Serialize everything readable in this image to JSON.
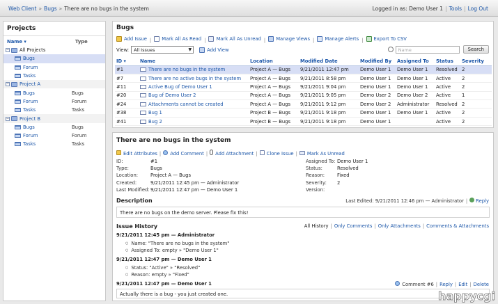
{
  "breadcrumb": [
    "Web Client",
    "Bugs",
    "There are no bugs in the system"
  ],
  "topbar": {
    "logged_in": "Logged in as: Demo User 1",
    "tools": "Tools",
    "logout": "Log Out"
  },
  "sidebar": {
    "title": "Projects",
    "col_name": "Name",
    "col_type": "Type",
    "rows": [
      {
        "label": "All Projects",
        "type": "",
        "kind": "root"
      },
      {
        "label": "Bugs",
        "type": "",
        "kind": "child"
      },
      {
        "label": "Forum",
        "type": "",
        "kind": "child"
      },
      {
        "label": "Tasks",
        "type": "",
        "kind": "child"
      },
      {
        "label": "Project A",
        "type": "",
        "kind": "project"
      },
      {
        "label": "Bugs",
        "type": "Bugs",
        "kind": "child"
      },
      {
        "label": "Forum",
        "type": "Forum",
        "kind": "child"
      },
      {
        "label": "Tasks",
        "type": "Tasks",
        "kind": "child"
      },
      {
        "label": "Project B",
        "type": "",
        "kind": "project"
      },
      {
        "label": "Bugs",
        "type": "Bugs",
        "kind": "child"
      },
      {
        "label": "Forum",
        "type": "Forum",
        "kind": "child"
      },
      {
        "label": "Tasks",
        "type": "Tasks",
        "kind": "child"
      }
    ]
  },
  "bugs": {
    "title": "Bugs",
    "toolbar": [
      "Add Issue",
      "Mark All As Read",
      "Mark All As Unread",
      "Manage Views",
      "Manage Alerts",
      "Export To CSV"
    ],
    "view_label": "View:",
    "view_value": "All Issues",
    "add_view": "Add View",
    "search_placeholder": "Name",
    "search_button": "Search",
    "columns": [
      "ID",
      "Name",
      "Location",
      "Modified Date",
      "Modified By",
      "Assigned To",
      "Status",
      "Severity"
    ],
    "rows": [
      [
        "#1",
        "There are no bugs in the system",
        "Project A — Bugs",
        "9/21/2011 12:47 pm",
        "Demo User 1",
        "Demo User 1",
        "Resolved",
        "2"
      ],
      [
        "#7",
        "There are no active bugs in the system",
        "Project A — Bugs",
        "9/21/2011 8:58 pm",
        "Demo User 1",
        "Demo User 1",
        "Active",
        "2"
      ],
      [
        "#11",
        "Active Bug of Demo User 1",
        "Project A — Bugs",
        "9/21/2011 9:04 pm",
        "Demo User 1",
        "Demo User 1",
        "Active",
        "2"
      ],
      [
        "#20",
        "Bug of Demo User 2",
        "Project A — Bugs",
        "9/21/2011 9:05 pm",
        "Demo User 2",
        "Demo User 2",
        "Active",
        "1"
      ],
      [
        "#24",
        "Attachments cannot be created",
        "Project A — Bugs",
        "9/21/2011 9:12 pm",
        "Demo User 2",
        "Administrator",
        "Resolved",
        "2"
      ],
      [
        "#38",
        "Bug 1",
        "Project B — Bugs",
        "9/21/2011 9:18 pm",
        "Demo User 1",
        "Demo User 1",
        "Active",
        "2"
      ],
      [
        "#41",
        "Bug 2",
        "Project B — Bugs",
        "9/21/2011 9:18 pm",
        "Demo User 1",
        "",
        "Active",
        "2"
      ]
    ]
  },
  "detail": {
    "title": "There are no bugs in the system",
    "toolbar": [
      "Edit Attributes",
      "Add Comment",
      "Add Attachment",
      "Clone Issue",
      "Mark As Unread"
    ],
    "left_props": [
      [
        "ID:",
        "#1"
      ],
      [
        "Type:",
        "Bugs"
      ],
      [
        "Location:",
        "Project A — Bugs"
      ],
      [
        "Created:",
        "9/21/2011 12:45 pm — Administrator"
      ],
      [
        "Last Modified:",
        "9/21/2011 12:47 pm — Demo User 1"
      ]
    ],
    "right_props": [
      [
        "Assigned To:",
        "Demo User 1"
      ],
      [
        "Status:",
        "Resolved"
      ],
      [
        "Reason:",
        "Fixed"
      ],
      [
        "Severity:",
        "2"
      ],
      [
        "Version:",
        ""
      ]
    ],
    "description_title": "Description",
    "last_edited": "Last Edited: 9/21/2011 12:46 pm — Administrator",
    "reply": "Reply",
    "description": "There are no bugs on the demo server. Please fix this!",
    "history_title": "Issue History",
    "history_links": [
      "All History",
      "Only Comments",
      "Only Attachments",
      "Comments & Attachments"
    ],
    "entries": [
      {
        "head": "9/21/2011 12:45 pm — Administrator",
        "items": [
          "Name: \"There are no bugs in the system\"",
          "Assigned To: empty » \"Demo User 1\""
        ]
      },
      {
        "head": "9/21/2011 12:47 pm — Demo User 1",
        "items": [
          "Status: \"Active\" » \"Resolved\"",
          "Reason: empty » \"Fixed\""
        ]
      },
      {
        "head": "9/21/2011 12:47 pm — Demo User 1",
        "items": []
      }
    ],
    "comment_label": "Comment #6",
    "comment_actions": [
      "Reply",
      "Edit",
      "Delete"
    ],
    "comment_text": "Actually there is a bug - you just created one."
  },
  "watermark": "happy·cgi",
  "colors": {
    "link": "#1a55a8",
    "selected_row": "#d7def5"
  }
}
